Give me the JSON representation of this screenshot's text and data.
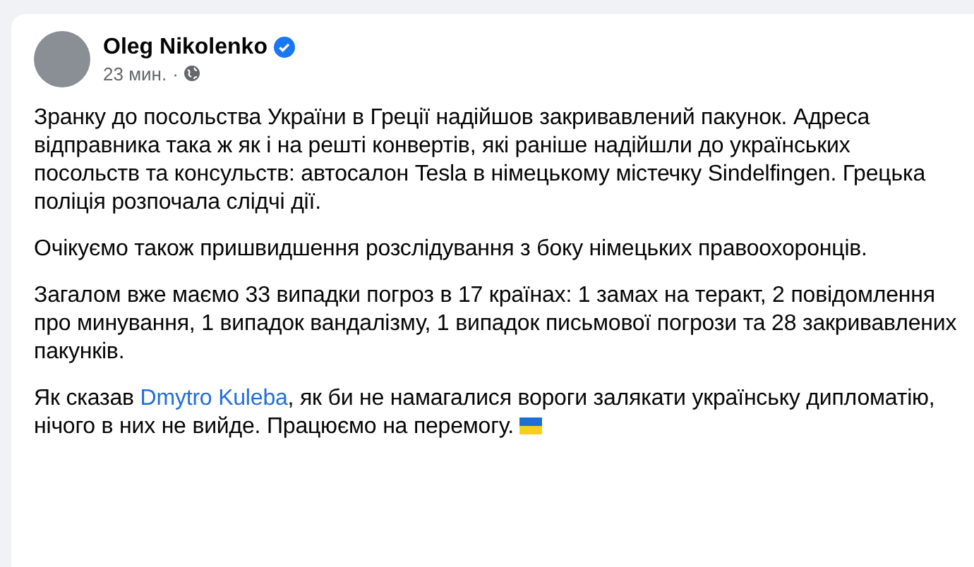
{
  "post": {
    "author": "Oleg Nikolenko",
    "verified": true,
    "time": "23 мин.",
    "separator": "·",
    "paragraphs": [
      {
        "segments": [
          {
            "kind": "text",
            "text": "Зранку до посольства України в Греції надійшов закривавлений пакунок. Адреса відправника така ж як і на решті конвертів, які раніше надійшли до українських посольств та консульств: автосалон Tesla в німецькому містечку Sindelfingen. Грецька поліція розпочала слідчі дії."
          }
        ],
        "flag": false
      },
      {
        "segments": [
          {
            "kind": "text",
            "text": "Очікуємо також пришвидшення розслідування з боку німецьких правоохоронців."
          }
        ],
        "flag": false
      },
      {
        "segments": [
          {
            "kind": "text",
            "text": "Загалом вже маємо 33 випадки погроз в 17 країнах: 1 замах на теракт, 2 повідомлення про минування, 1 випадок вандалізму, 1 випадок письмової погрози та 28 закривавлених пакунків."
          }
        ],
        "flag": false
      },
      {
        "segments": [
          {
            "kind": "text",
            "text": "Як сказав "
          },
          {
            "kind": "link",
            "text": "Dmytro Kuleba"
          },
          {
            "kind": "text",
            "text": ", як би не намагалися вороги залякати українську дипломатію, нічого в них не вийде. Працюємо на перемогу."
          }
        ],
        "flag": true
      }
    ]
  }
}
